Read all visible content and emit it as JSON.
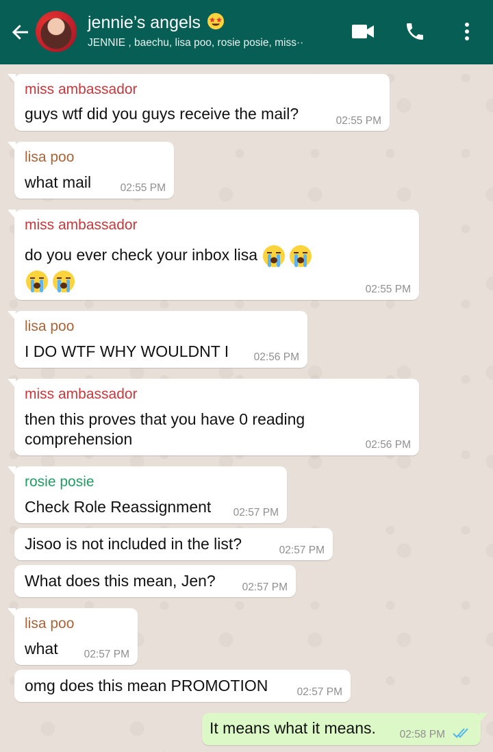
{
  "header": {
    "title": "jennie’s angels",
    "subtitle": "JENNIE , baechu, lisa poo, rosie posie, miss··",
    "colors": {
      "bar": "#075e54"
    },
    "icons": [
      "back-arrow-icon",
      "video-call-icon",
      "phone-icon",
      "more-vert-icon",
      "star-struck-emoji"
    ]
  },
  "messages": [
    {
      "sender": "miss ambassador",
      "lines": [
        "guys wtf did you guys receive the mail?"
      ],
      "time": "02:55 PM"
    },
    {
      "sender": "lisa poo",
      "lines": [
        "what mail"
      ],
      "time": "02:55 PM"
    },
    {
      "sender": "miss ambassador",
      "lines": [
        "do you ever check your inbox lisa"
      ],
      "time": "02:55 PM",
      "emoji": "loudly-crying-face"
    },
    {
      "sender": "lisa poo",
      "lines": [
        "I DO WTF WHY WOULDNT I"
      ],
      "time": "02:56 PM"
    },
    {
      "sender": "miss ambassador",
      "lines": [
        "then this proves that you have 0 reading",
        "comprehension"
      ],
      "time": "02:56 PM"
    },
    {
      "sender": "rosie posie",
      "lines": [
        "Check Role Reassignment"
      ],
      "time": "02:57 PM"
    },
    {
      "sender": "",
      "lines": [
        "Jisoo is not included in the list?"
      ],
      "time": "02:57 PM"
    },
    {
      "sender": "",
      "lines": [
        "What does this mean, Jen?"
      ],
      "time": "02:57 PM"
    },
    {
      "sender": "lisa poo",
      "lines": [
        "what"
      ],
      "time": "02:57 PM"
    },
    {
      "sender": "",
      "lines": [
        "omg does this mean PROMOTION"
      ],
      "time": "02:57 PM"
    },
    {
      "sender": "",
      "lines": [
        "It means what it means."
      ],
      "time": "02:58 PM",
      "outgoing": true,
      "status": "read-double-check"
    }
  ],
  "colors": {
    "sender_red": "#c8373b",
    "sender_brown": "#a86437",
    "sender_green": "#1f9d63",
    "outgoing_bubble": "#dcf8c6",
    "read_tick": "#4fb6ec"
  }
}
